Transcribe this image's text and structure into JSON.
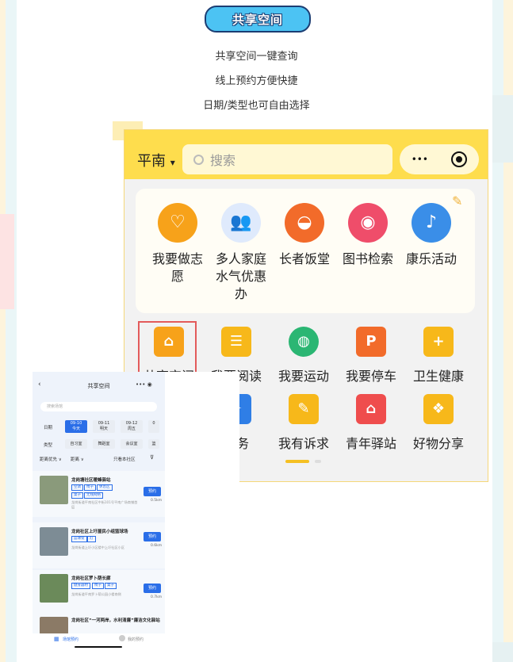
{
  "header": {
    "badge": "共享空间",
    "lines": [
      "共享空间一键查询",
      "线上预约方便快捷",
      "日期/类型也可自由选择"
    ]
  },
  "app": {
    "city": "平南",
    "city_caret": "▾",
    "search_placeholder": "搜索",
    "more": "•••",
    "card_items": [
      {
        "label": "我要做志愿",
        "icon": "heart-icon",
        "color": "#f7a21a"
      },
      {
        "label": "多人家庭水气优惠办",
        "icon": "users-icon",
        "color": "#2f7ee6"
      },
      {
        "label": "长者饭堂",
        "icon": "bowl-icon",
        "color": "#f26b2a"
      },
      {
        "label": "图书检索",
        "icon": "search-book-icon",
        "color": "#ef4d6a"
      },
      {
        "label": "康乐活动",
        "icon": "dance-icon",
        "color": "#3a8ee8"
      }
    ],
    "grid_row1": [
      {
        "label": "共享空间",
        "icon": "house-icon",
        "color": "#f7a21a"
      },
      {
        "label": "我要阅读",
        "icon": "book-icon",
        "color": "#f7b81a"
      },
      {
        "label": "我要运动",
        "icon": "ball-icon",
        "color": "#2bb673"
      },
      {
        "label": "我要停车",
        "icon": "parking-icon",
        "color": "#f26b2a"
      },
      {
        "label": "卫生健康",
        "icon": "medkit-icon",
        "color": "#f7b81a"
      }
    ],
    "grid_row2": [
      {
        "label": "服务",
        "icon": "service-icon",
        "color": "#2f7ee6"
      },
      {
        "label": "我有诉求",
        "icon": "edit-icon",
        "color": "#f7b81a"
      },
      {
        "label": "青年驿站",
        "icon": "station-icon",
        "color": "#ef4d4d"
      },
      {
        "label": "好物分享",
        "icon": "gift-icon",
        "color": "#f7b81a"
      }
    ]
  },
  "phone": {
    "title": "共享空间",
    "back": "‹",
    "capsule": "••• ◉",
    "search": "搜索场馆",
    "date_label": "日期",
    "dates": [
      {
        "d": "09-10",
        "w": "今天"
      },
      {
        "d": "09-11",
        "w": "明天"
      },
      {
        "d": "09-12",
        "w": "周五"
      },
      {
        "d": "0",
        "w": ""
      }
    ],
    "type_label": "类型",
    "types": [
      "自习室",
      "舞蹈室",
      "会议室",
      "篮"
    ],
    "sort": "距离优先 ∨",
    "dist": "距离 ∨",
    "only_community": "只看本社区",
    "items": [
      {
        "name": "龙岗塘社区暖蜂驿站",
        "tags": [
          "空调",
          "椅子",
          "休息区"
        ],
        "tags2": [
          "桌子",
          "无线网络"
        ],
        "desc": "龙岗街道平南社区中街101号平南广场商铺首层",
        "dist": "0.5km"
      },
      {
        "name": "龙岗社区上圩屋民小组篮球场",
        "tags": [
          "篮球架",
          "灯"
        ],
        "tags2": [],
        "desc": "龙岗街道上圩小区楼中上圩社区小区",
        "dist": "0.6km"
      },
      {
        "name": "龙岗社区罗卜荫长廊",
        "tags": [
          "健身器材",
          "椅子",
          "桌子"
        ],
        "tags2": [],
        "desc": "龙岗街道平南罗卜荫公园小楼南侧",
        "dist": "0.7km"
      },
      {
        "name": "龙岗社区“一河两岸，水利清廉”廉洁文化驿站",
        "tags": [],
        "tags2": [],
        "desc": "",
        "dist": ""
      }
    ],
    "book_btn": "预约",
    "nav": [
      "场馆预约",
      "我的预约"
    ]
  }
}
